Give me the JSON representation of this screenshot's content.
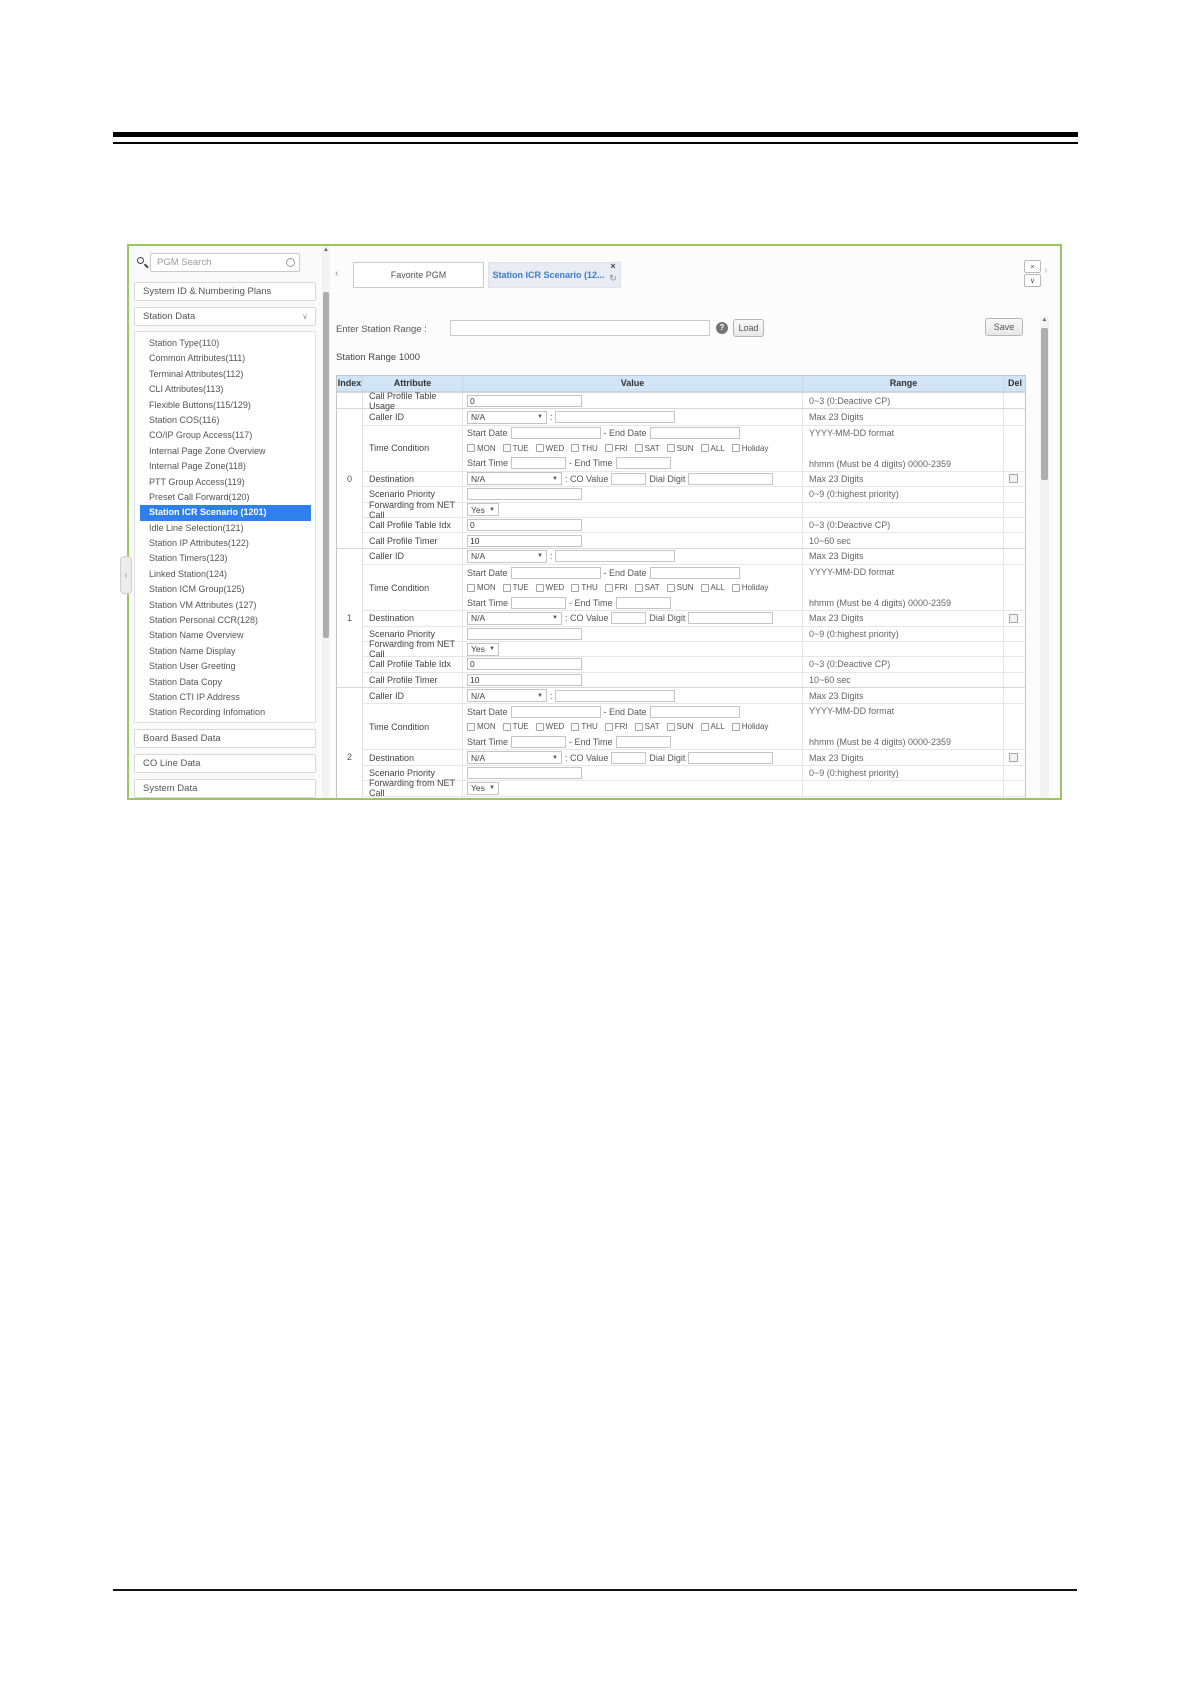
{
  "sidebar": {
    "search_placeholder": "PGM Search",
    "sections": {
      "system_id": "System ID & Numbering Plans",
      "station_data": "Station Data",
      "board_based": "Board Based Data",
      "co_line": "CO Line Data",
      "system": "System Data"
    },
    "items_top": [
      "Station Type(110)",
      "Common Attributes(111)",
      "Terminal Attributes(112)",
      "CLI Attributes(113)",
      "Flexible Buttons(115/129)",
      "Station COS(116)",
      "CO/IP Group Access(117)",
      "Internal Page Zone Overview",
      "Internal Page Zone(118)",
      "PTT Group Access(119)",
      "Preset Call Forward(120)"
    ],
    "selected_item": "Station ICR Scenario (1201)",
    "items_bottom": [
      "Idle Line Selection(121)",
      "Station IP Attributes(122)",
      "Station Timers(123)",
      "Linked Station(124)",
      "Station ICM Group(125)",
      "Station VM Attributes (127)",
      "Station Personal CCR(128)",
      "Station Name Overview",
      "Station Name Display",
      "Station User Greeting",
      "Station Data Copy",
      "Station CTI IP Address",
      "Station Recording Infomation"
    ]
  },
  "tabs": {
    "left_chevron": "‹",
    "favorite": "Favorite PGM",
    "active": "Station ICR Scenario (12...",
    "close_glyph": "×",
    "refresh_glyph": "↻",
    "window_close": "×",
    "window_collapse": "∨",
    "right_chevron": "›"
  },
  "toolbar": {
    "range_label": "Enter Station Range :",
    "help": "?",
    "load": "Load",
    "save": "Save"
  },
  "subtitle": "Station Range 1000",
  "table": {
    "headers": [
      "Index",
      "Attribute",
      "Value",
      "Range",
      "Del"
    ],
    "indices": [
      "0",
      "1",
      "2"
    ],
    "labels": {
      "usage": "Call Profile Table Usage",
      "caller": "Caller ID",
      "time": "Time Condition",
      "dest": "Destination",
      "prio": "Scenario Priority",
      "fwd": "Forwarding from NET Call",
      "idx": "Call Profile Table Idx",
      "timer": "Call Profile Timer",
      "start_date": "Start Date",
      "end_date": "- End Date",
      "start_time": "Start Time",
      "end_time": "- End Time",
      "colon": ":",
      "co_value": ": CO Value",
      "dial_digit": "Dial Digit"
    },
    "days": [
      "MON",
      "TUE",
      "WED",
      "THU",
      "FRI",
      "SAT",
      "SUN",
      "ALL",
      "Holiday"
    ],
    "ranges": {
      "usage": "0~3 (0:Deactive CP)",
      "caller": "Max 23 Digits",
      "date": "YYYY-MM-DD format",
      "time": "hhmm (Must be 4 digits) 0000-2359",
      "dest": "Max 23 Digits",
      "prio": "0~9 (0:highest priority)",
      "idx": "0~3 (0:Deactive CP)",
      "timer": "10~60 sec"
    },
    "values": {
      "usage": "0",
      "na": "N/A",
      "yes": "Yes",
      "idx": "0",
      "timer": "10"
    },
    "accent_colors": {
      "panel_border": "#9dc45f",
      "selected_item": "#2f80ed",
      "active_tab_text": "#3d7cc9",
      "header_bg": "#d2e5f6"
    }
  }
}
